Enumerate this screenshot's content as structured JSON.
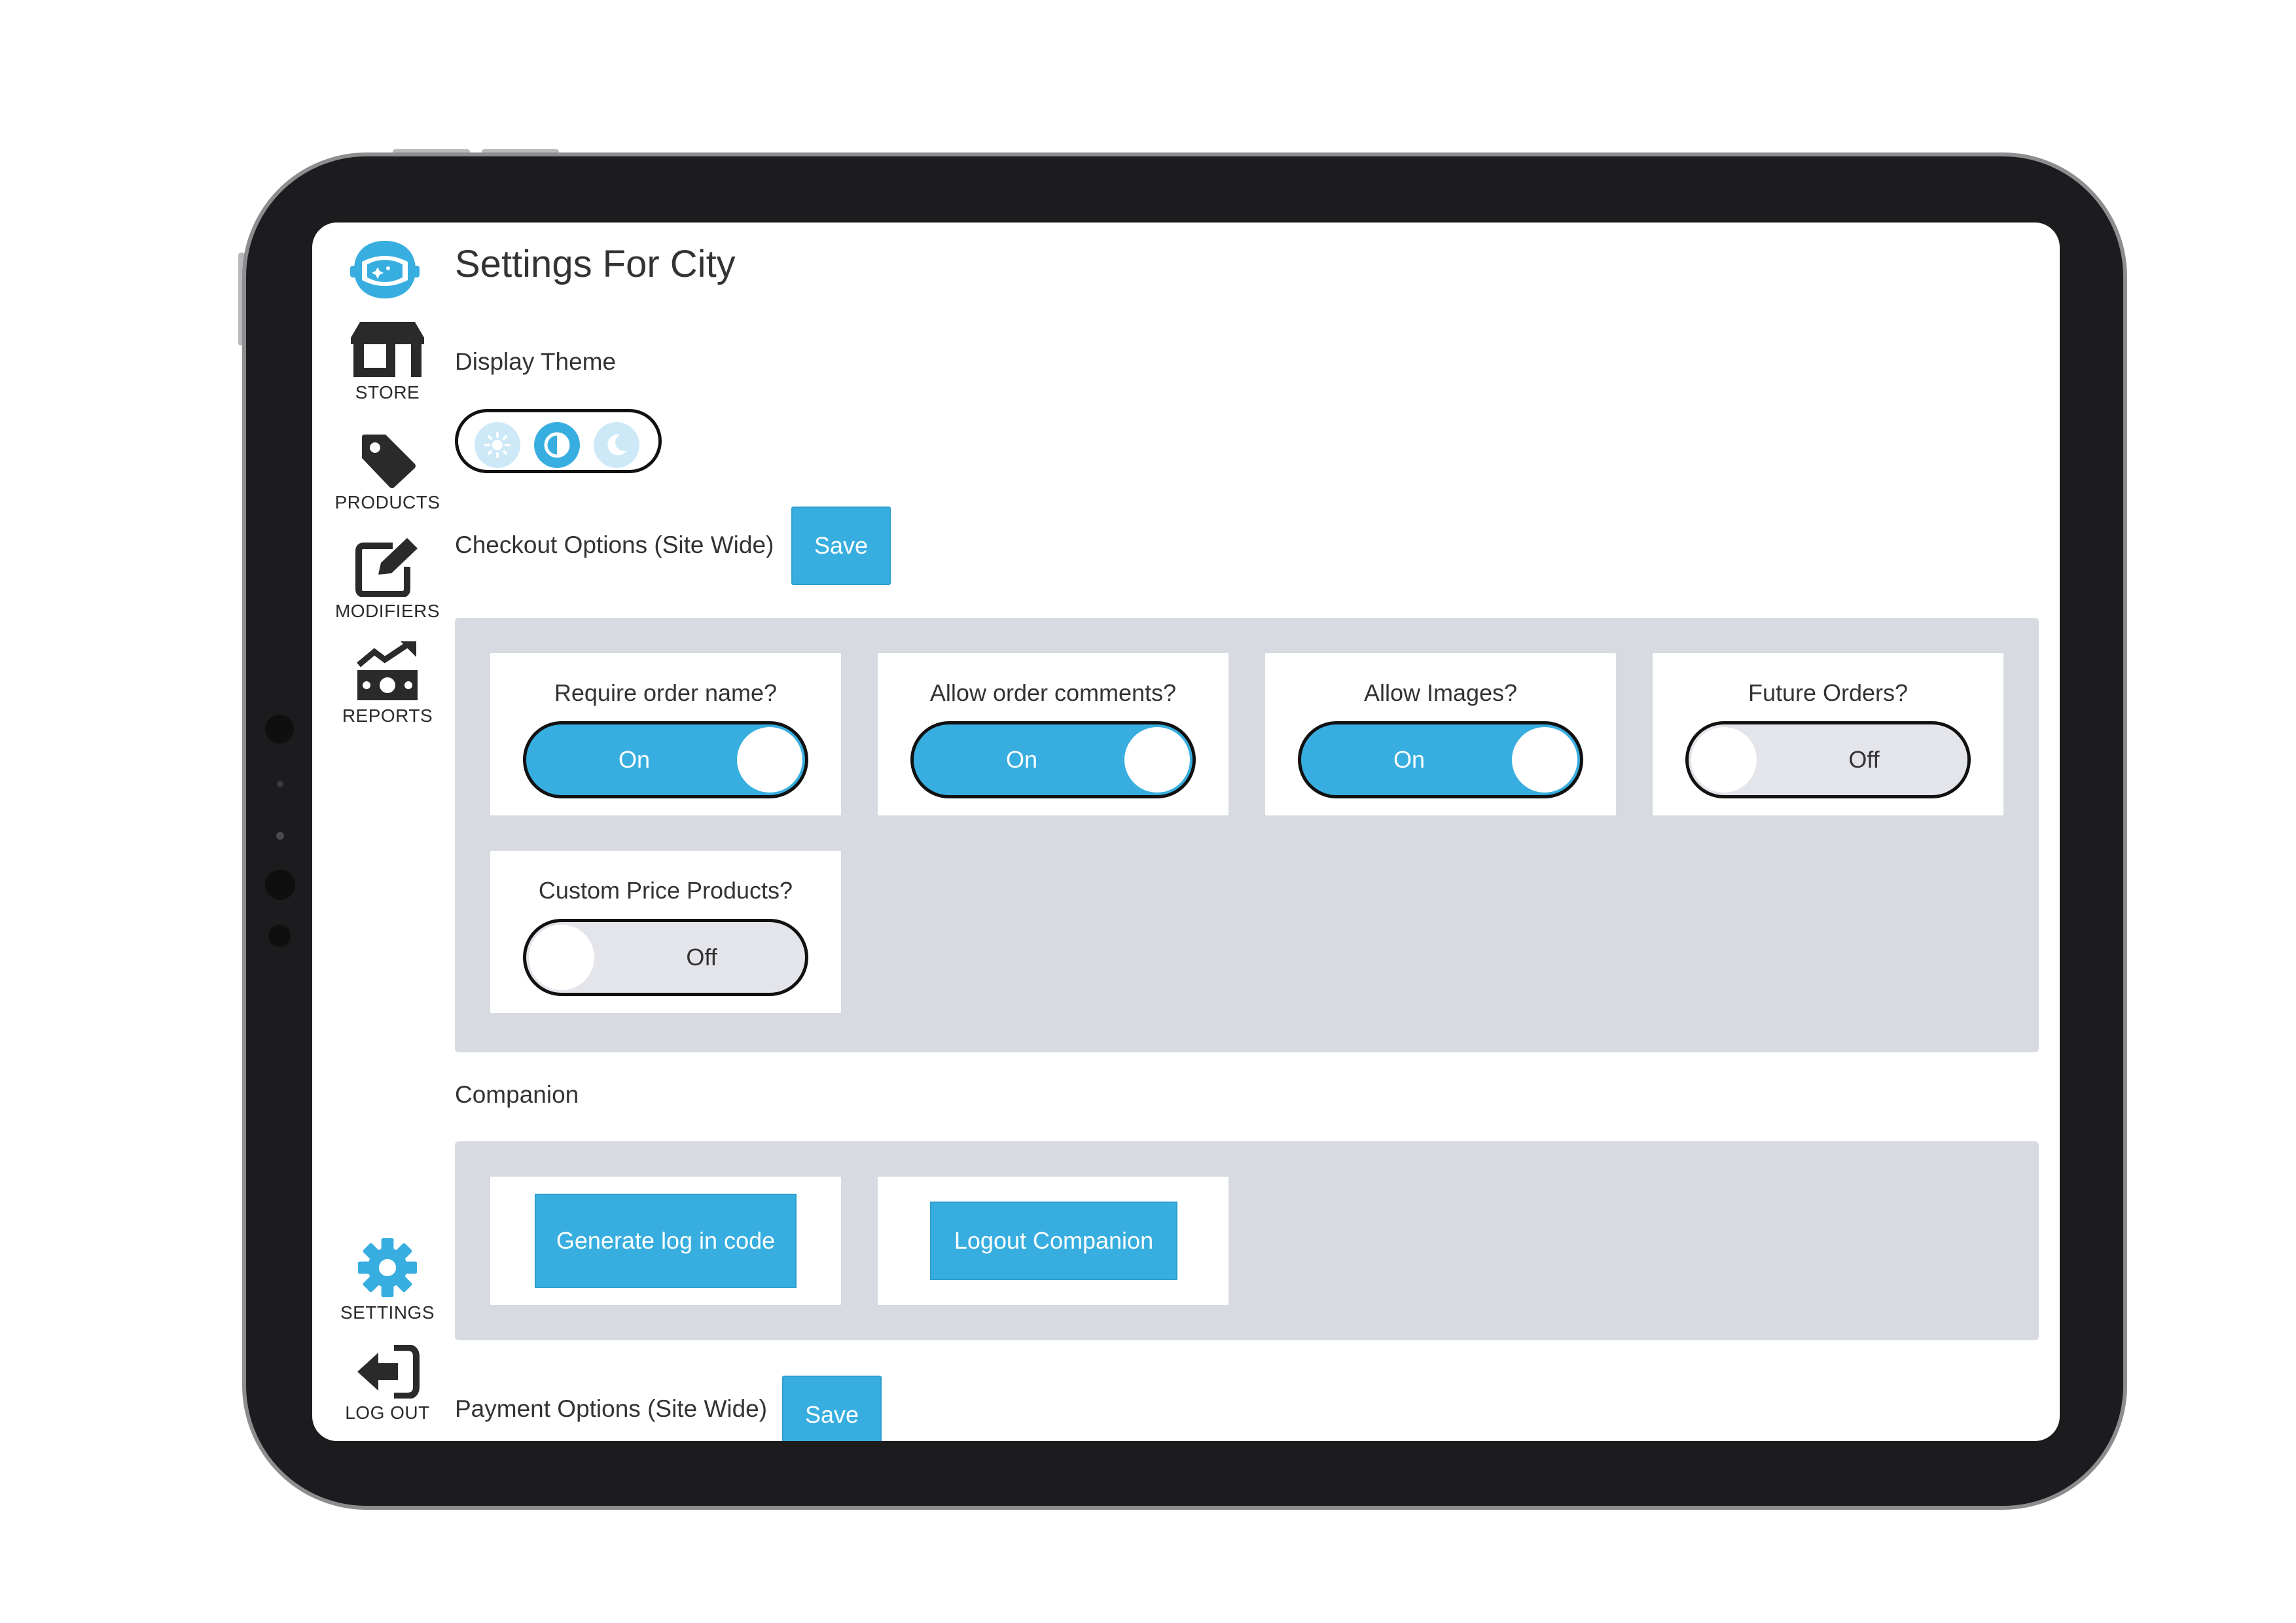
{
  "page": {
    "title": "Settings For City"
  },
  "sidebar": {
    "items": [
      {
        "id": "store",
        "label": "STORE",
        "icon": "store-icon"
      },
      {
        "id": "products",
        "label": "PRODUCTS",
        "icon": "tag-icon"
      },
      {
        "id": "modifiers",
        "label": "MODIFIERS",
        "icon": "edit-icon"
      },
      {
        "id": "reports",
        "label": "REPORTS",
        "icon": "money-chart-icon"
      },
      {
        "id": "settings",
        "label": "SETTINGS",
        "icon": "gear-icon",
        "active": true
      },
      {
        "id": "logout",
        "label": "LOG OUT",
        "icon": "logout-icon"
      }
    ]
  },
  "display_theme": {
    "label": "Display Theme",
    "options": [
      "light",
      "auto",
      "dark"
    ],
    "selected": "auto"
  },
  "checkout": {
    "label": "Checkout Options (Site Wide)",
    "save_label": "Save",
    "options": [
      {
        "title": "Require order name?",
        "state": "On"
      },
      {
        "title": "Allow order comments?",
        "state": "On"
      },
      {
        "title": "Allow Images?",
        "state": "On"
      },
      {
        "title": "Future Orders?",
        "state": "Off"
      },
      {
        "title": "Custom Price Products?",
        "state": "Off"
      }
    ]
  },
  "companion": {
    "label": "Companion",
    "generate_label": "Generate log in code",
    "logout_label": "Logout Companion"
  },
  "payment": {
    "label": "Payment Options (Site Wide)",
    "save_label": "Save"
  },
  "colors": {
    "accent": "#37aedf",
    "panel": "#d8dae2",
    "frame": "#1c1c1e",
    "toggle_off": "#e4e5ea"
  }
}
